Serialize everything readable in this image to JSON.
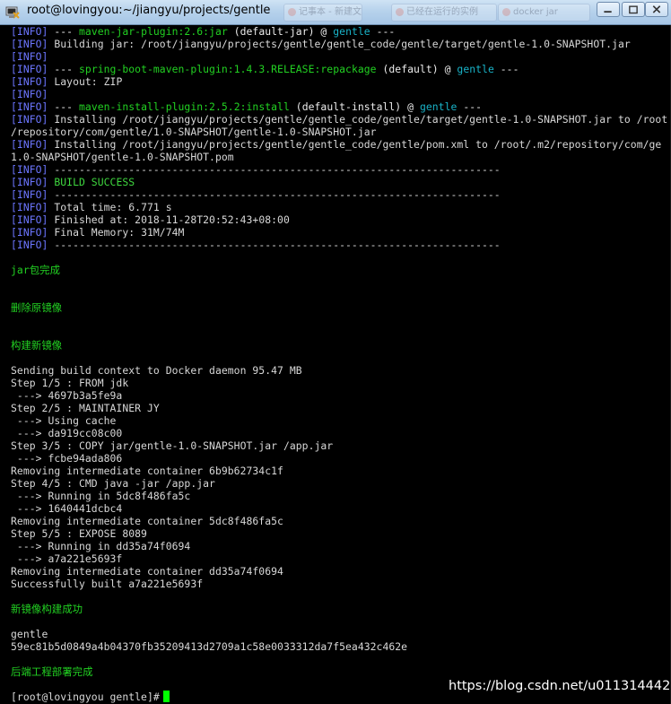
{
  "window": {
    "title": "root@lovingyou:~/jiangyu/projects/gentle",
    "background_tabs": [
      "记事本 - 新建文本文档",
      "已经在运行的实例",
      "docker jar"
    ],
    "app_icon": "putty-terminal-icon"
  },
  "terminal": {
    "lines": [
      [
        {
          "t": "[INFO]",
          "c": "tag"
        },
        {
          "t": " --- ",
          "c": "hl"
        },
        {
          "t": "maven-jar-plugin:2.6:jar",
          "c": "green"
        },
        {
          "t": " (default-jar) ",
          "c": "hl"
        },
        {
          "t": "@ ",
          "c": "hl"
        },
        {
          "t": "gentle",
          "c": "cyan"
        },
        {
          "t": " ---",
          "c": "hl"
        }
      ],
      [
        {
          "t": "[INFO]",
          "c": "tag"
        },
        {
          "t": " Building jar: /root/jiangyu/projects/gentle/gentle_code/gentle/target/gentle-1.0-SNAPSHOT.jar",
          "c": ""
        }
      ],
      [
        {
          "t": "[INFO]",
          "c": "tag"
        }
      ],
      [
        {
          "t": "[INFO]",
          "c": "tag"
        },
        {
          "t": " --- ",
          "c": "hl"
        },
        {
          "t": "spring-boot-maven-plugin:1.4.3.RELEASE:repackage",
          "c": "green"
        },
        {
          "t": " (default) ",
          "c": "hl"
        },
        {
          "t": "@ ",
          "c": "hl"
        },
        {
          "t": "gentle",
          "c": "cyan"
        },
        {
          "t": " ---",
          "c": "hl"
        }
      ],
      [
        {
          "t": "[INFO]",
          "c": "tag"
        },
        {
          "t": " Layout: ZIP",
          "c": ""
        }
      ],
      [
        {
          "t": "[INFO]",
          "c": "tag"
        }
      ],
      [
        {
          "t": "[INFO]",
          "c": "tag"
        },
        {
          "t": " --- ",
          "c": "hl"
        },
        {
          "t": "maven-install-plugin:2.5.2:install",
          "c": "green"
        },
        {
          "t": " (default-install) ",
          "c": "hl"
        },
        {
          "t": "@ ",
          "c": "hl"
        },
        {
          "t": "gentle",
          "c": "cyan"
        },
        {
          "t": " ---",
          "c": "hl"
        }
      ],
      [
        {
          "t": "[INFO]",
          "c": "tag"
        },
        {
          "t": " Installing /root/jiangyu/projects/gentle/gentle_code/gentle/target/gentle-1.0-SNAPSHOT.jar to /root",
          "c": ""
        }
      ],
      [
        {
          "t": "/repository/com/gentle/1.0-SNAPSHOT/gentle-1.0-SNAPSHOT.jar",
          "c": ""
        }
      ],
      [
        {
          "t": "[INFO]",
          "c": "tag"
        },
        {
          "t": " Installing /root/jiangyu/projects/gentle/gentle_code/gentle/pom.xml to /root/.m2/repository/com/ge",
          "c": ""
        }
      ],
      [
        {
          "t": "1.0-SNAPSHOT/gentle-1.0-SNAPSHOT.pom",
          "c": ""
        }
      ],
      [
        {
          "t": "[INFO]",
          "c": "tag"
        },
        {
          "t": " ------------------------------------------------------------------------",
          "c": ""
        }
      ],
      [
        {
          "t": "[INFO]",
          "c": "tag"
        },
        {
          "t": " BUILD SUCCESS",
          "c": "bgreen"
        }
      ],
      [
        {
          "t": "[INFO]",
          "c": "tag"
        },
        {
          "t": " ------------------------------------------------------------------------",
          "c": ""
        }
      ],
      [
        {
          "t": "[INFO]",
          "c": "tag"
        },
        {
          "t": " Total time: 6.771 s",
          "c": ""
        }
      ],
      [
        {
          "t": "[INFO]",
          "c": "tag"
        },
        {
          "t": " Finished at: 2018-11-28T20:52:43+08:00",
          "c": ""
        }
      ],
      [
        {
          "t": "[INFO]",
          "c": "tag"
        },
        {
          "t": " Final Memory: 31M/74M",
          "c": ""
        }
      ],
      [
        {
          "t": "[INFO]",
          "c": "tag"
        },
        {
          "t": " ------------------------------------------------------------------------",
          "c": ""
        }
      ],
      [],
      [
        {
          "t": "jar包完成",
          "c": "green"
        }
      ],
      [],
      [],
      [
        {
          "t": "删除原镜像",
          "c": "green"
        }
      ],
      [],
      [],
      [
        {
          "t": "构建新镜像",
          "c": "green"
        }
      ],
      [],
      [
        {
          "t": "Sending build context to Docker daemon 95.47 MB",
          "c": ""
        }
      ],
      [
        {
          "t": "Step 1/5 : FROM jdk",
          "c": ""
        }
      ],
      [
        {
          "t": " ---> 4697b3a5fe9a",
          "c": ""
        }
      ],
      [
        {
          "t": "Step 2/5 : MAINTAINER JY",
          "c": ""
        }
      ],
      [
        {
          "t": " ---> Using cache",
          "c": ""
        }
      ],
      [
        {
          "t": " ---> da919cc08c00",
          "c": ""
        }
      ],
      [
        {
          "t": "Step 3/5 : COPY jar/gentle-1.0-SNAPSHOT.jar /app.jar",
          "c": ""
        }
      ],
      [
        {
          "t": " ---> fcbe94ada806",
          "c": ""
        }
      ],
      [
        {
          "t": "Removing intermediate container 6b9b62734c1f",
          "c": ""
        }
      ],
      [
        {
          "t": "Step 4/5 : CMD java -jar /app.jar",
          "c": ""
        }
      ],
      [
        {
          "t": " ---> Running in 5dc8f486fa5c",
          "c": ""
        }
      ],
      [
        {
          "t": " ---> 1640441dcbc4",
          "c": ""
        }
      ],
      [
        {
          "t": "Removing intermediate container 5dc8f486fa5c",
          "c": ""
        }
      ],
      [
        {
          "t": "Step 5/5 : EXPOSE 8089",
          "c": ""
        }
      ],
      [
        {
          "t": " ---> Running in dd35a74f0694",
          "c": ""
        }
      ],
      [
        {
          "t": " ---> a7a221e5693f",
          "c": ""
        }
      ],
      [
        {
          "t": "Removing intermediate container dd35a74f0694",
          "c": ""
        }
      ],
      [
        {
          "t": "Successfully built a7a221e5693f",
          "c": ""
        }
      ],
      [],
      [
        {
          "t": "新镜像构建成功",
          "c": "green"
        }
      ],
      [],
      [
        {
          "t": "gentle",
          "c": ""
        }
      ],
      [
        {
          "t": "59ec81b5d0849a4b04370fb35209413d2709a1c58e0033312da7f5ea432c462e",
          "c": ""
        }
      ],
      [],
      [
        {
          "t": "后端工程部署完成",
          "c": "green"
        }
      ],
      [],
      [
        {
          "t": "[root@lovingyou gentle]# ",
          "c": ""
        }
      ]
    ]
  },
  "watermark": "https://blog.csdn.net/u011314442",
  "colors": {
    "info_tag": "#6c76ff",
    "plugin": "#22d122",
    "project": "#19b3c8",
    "success": "#3fd83f",
    "text": "#d8d8d8",
    "background": "#000000"
  }
}
